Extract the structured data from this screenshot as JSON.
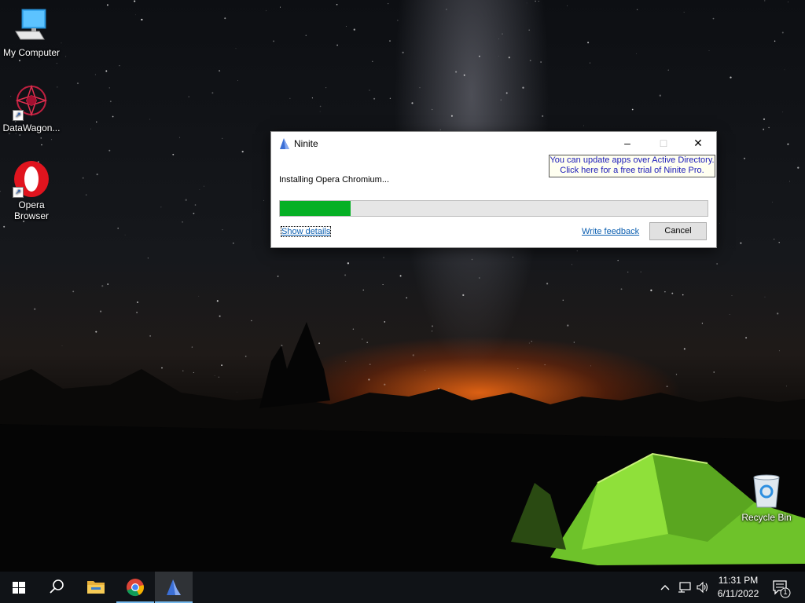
{
  "desktop": {
    "icons": [
      {
        "label": "My Computer",
        "icon": "computer-icon"
      },
      {
        "label": "DataWagon...",
        "icon": "datawagon-icon"
      },
      {
        "label": "Opera\nBrowser",
        "icon": "opera-icon"
      },
      {
        "label": "Recycle Bin",
        "icon": "recycle-bin-icon"
      }
    ]
  },
  "window": {
    "title": "Ninite",
    "promo_line1": "You can update apps over Active Directory.",
    "promo_line2": "Click here for a free trial of Ninite Pro.",
    "status": "Installing Opera Chromium...",
    "progress": 0.165,
    "show_details": "Show details",
    "write_feedback": "Write feedback",
    "cancel": "Cancel",
    "minimize_glyph": "–",
    "maximize_glyph": "□",
    "close_glyph": "✕",
    "progress_color": "#06b025"
  },
  "taskbar": {
    "items": [
      "start-icon",
      "search-icon",
      "file-explorer-icon",
      "chrome-icon",
      "ninite-icon"
    ],
    "time": "11:31 PM",
    "date": "6/11/2022",
    "notification_count": "1"
  }
}
